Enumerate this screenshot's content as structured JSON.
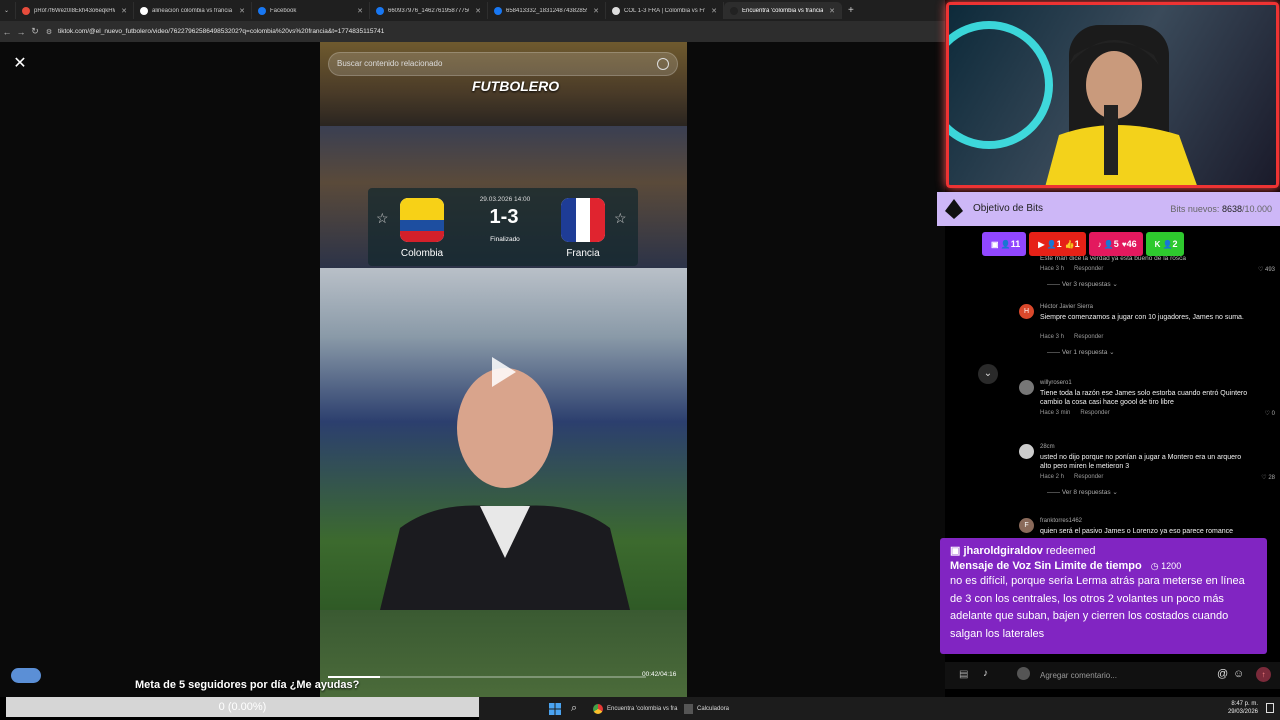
{
  "browser": {
    "tabs": [
      {
        "label": "pRof7f6Wez0l8Ekh43o6eqkHW",
        "color": "#e74c3c",
        "active": false
      },
      {
        "label": "alineacion colombia vs francia",
        "color": "#ffffff",
        "active": false
      },
      {
        "label": "Facebook",
        "color": "#1877f2",
        "active": false
      },
      {
        "label": "660937976_1462761958777563",
        "color": "#1877f2",
        "active": false
      },
      {
        "label": "658413332_1831248743828590",
        "color": "#1877f2",
        "active": false
      },
      {
        "label": "COL 1-3 FRA | Colombia vs Fra",
        "color": "#dddddd",
        "active": false
      },
      {
        "label": "Encuentra 'colombia vs francia'",
        "color": "#222222",
        "active": true
      }
    ],
    "url": "tiktok.com/@el_nuevo_futbolero/video/7622796258649853202?q=colombia%20vs%20francia&t=1774835115741"
  },
  "video": {
    "search_placeholder": "Buscar contenido relacionado",
    "logo": "FUTBOLERO",
    "match": {
      "date": "29.03.2026 14:00",
      "score": "1-3",
      "status": "Finalizado",
      "home": "Colombia",
      "away": "Francia"
    },
    "time": "00:42/04:16",
    "progress": 0.164
  },
  "comments": [
    {
      "user": "",
      "text": "Este man dice la verdad ya está bueno de la rosca",
      "time": "Hace 3 h",
      "reply": "Responder",
      "likes": "493",
      "replies": "Ver 3 respuestas",
      "avatar": "",
      "avatar_color": "#555555"
    },
    {
      "user": "Héctor Javier Sierra",
      "text": "Siempre comenzamos a jugar con 10 jugadores, James no suma.",
      "time": "Hace 3 h",
      "reply": "Responder",
      "likes": "",
      "replies": "Ver 1 respuesta",
      "avatar": "H",
      "avatar_color": "#d9482b"
    },
    {
      "user": "willyrosero1",
      "text": "Tiene toda la razón ese James solo estorba cuando entró Quintero cambio la cosa casi hace goool de tiro libre",
      "time": "Hace 3 min",
      "reply": "Responder",
      "likes": "0",
      "replies": "",
      "avatar": "",
      "avatar_color": "#777777"
    },
    {
      "user": "28cm",
      "text": "usted no dijo porque no ponían a jugar a Montero era un arquero alto pero miren le metieron 3",
      "time": "Hace 2 h",
      "reply": "Responder",
      "likes": "28",
      "replies": "Ver 8 respuestas",
      "avatar": "",
      "avatar_color": "#cccccc"
    },
    {
      "user": "franktorres1462",
      "text": "quien será el pasivo James o Lorenzo ya eso parece romance",
      "time": "",
      "reply": "",
      "likes": "",
      "replies": "",
      "avatar": "F",
      "avatar_color": "#8a6a5a"
    }
  ],
  "overlay": {
    "bits_label": "Objetivo de Bits",
    "bits_prefix": "Bits nuevos:",
    "bits_current": "8638",
    "bits_goal": "/10.000",
    "pills": [
      {
        "icon": "twitch-icon",
        "text": "11",
        "color": "#9147ff"
      },
      {
        "icon": "youtube-icon",
        "text": "1",
        "color": "#e62117"
      },
      {
        "icon": "like-icon",
        "text": "1",
        "color": "#e62117"
      },
      {
        "icon": "tiktok-icon",
        "text": "5",
        "color": "#e3195e"
      },
      {
        "icon": "heart-icon",
        "text": "46",
        "color": "#e3195e"
      },
      {
        "icon": "kick-icon",
        "text": "2",
        "color": "#2ec92e"
      }
    ],
    "redeem": {
      "user": "jharoldgiraldov",
      "action": "redeemed",
      "title": "Mensaje de Voz Sin Limite de tiempo",
      "cost": "1200",
      "message": "no es difícil, porque sería Lerma atrás para meterse en línea de 3 con los centrales, los otros 2 volantes un poco más adelante que suban, bajen y cierren los costados cuando salgan los laterales"
    },
    "comment_placeholder": "Agregar comentario...",
    "goal_text": "Meta de 5 seguidores por día ¿Me ayudas?",
    "goal_value": "0 (0.00%)"
  },
  "taskbar": {
    "chrome_label": "Encuentra 'colombia vs fra",
    "calc_label": "Calculadora",
    "time": "8:47 p. m.",
    "date": "29/03/2026"
  }
}
